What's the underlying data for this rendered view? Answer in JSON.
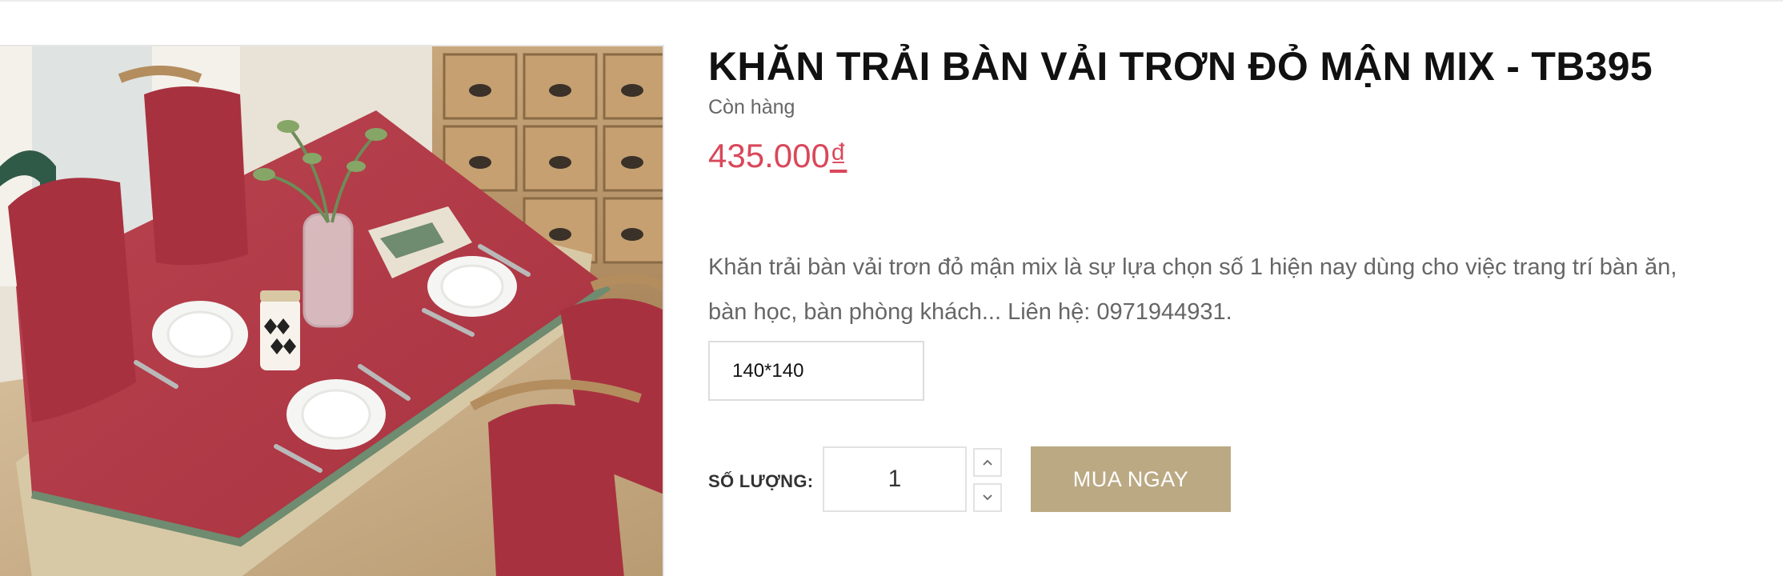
{
  "product": {
    "title": "KHĂN TRẢI BÀN VẢI TRƠN ĐỎ MẬN MIX - TB395",
    "stock_status": "Còn hàng",
    "price_amount": "435.000",
    "price_currency": "₫",
    "description": "Khăn trải bàn vải trơn đỏ mận mix là sự lựa chọn số 1 hiện nay dùng cho việc trang trí bàn ăn, bàn học, bàn phòng khách... Liên hệ: 0971944931.",
    "image_name": "red-tablecloth-photo"
  },
  "variant": {
    "selected": "140*140"
  },
  "quantity": {
    "label": "SỐ LƯỢNG:",
    "value": "1",
    "up_icon": "chevron-up-icon",
    "down_icon": "chevron-down-icon"
  },
  "buy_button": {
    "label": "MUA NGAY"
  },
  "colors": {
    "price": "#d9485b",
    "buy_button_bg": "#bba984",
    "tablecloth": "#b03a48"
  }
}
